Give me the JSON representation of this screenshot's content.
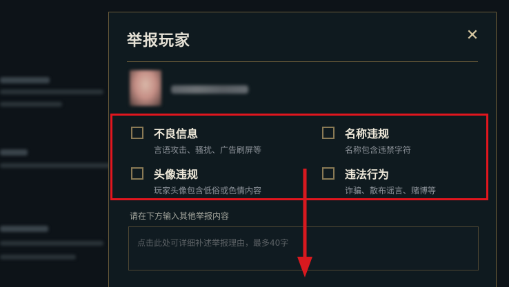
{
  "dialog": {
    "title": "举报玩家",
    "close_icon": "close-icon"
  },
  "options": [
    {
      "label": "不良信息",
      "desc": "言语攻击、骚扰、广告刷屏等",
      "checked": false
    },
    {
      "label": "名称违规",
      "desc": "名称包含违禁字符",
      "checked": false
    },
    {
      "label": "头像违规",
      "desc": "玩家头像包含低俗或色情内容",
      "checked": false
    },
    {
      "label": "违法行为",
      "desc": "诈骗、散布谣言、赌博等",
      "checked": false
    }
  ],
  "details": {
    "prompt": "请在下方输入其他举报内容",
    "placeholder": "点击此处可详细补述举报理由，最多40字"
  },
  "colors": {
    "gold_border": "#6a5c3a",
    "highlight_red": "#e1161e",
    "background": "#0d1318"
  }
}
